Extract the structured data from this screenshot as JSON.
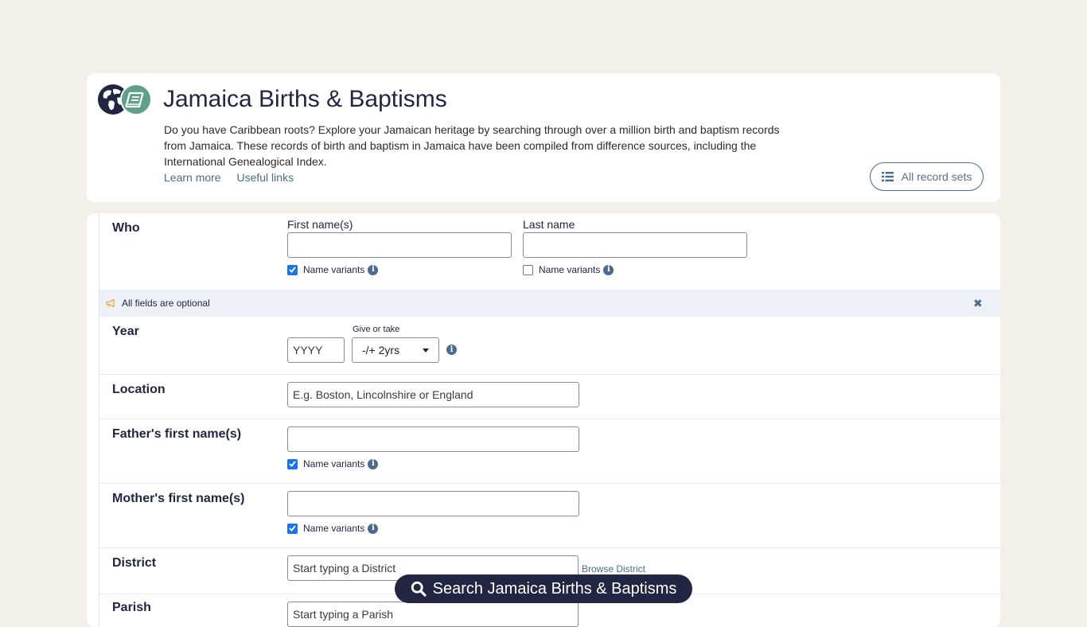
{
  "header": {
    "title": "Jamaica Births & Baptisms",
    "description": "Do you have Caribbean roots? Explore your Jamaican heritage by searching through over a million birth and baptism records from Jamaica. These records of birth and baptism in Jamaica have been compiled from difference sources, including the International Genealogical Index.",
    "learn_more": "Learn more",
    "useful_links": "Useful links",
    "all_record_sets": "All record sets",
    "icons": [
      "globe-icon",
      "book-icon",
      "list-icon"
    ]
  },
  "form": {
    "who": {
      "label": "Who",
      "first_name_label": "First name(s)",
      "first_name_value": "",
      "first_name_variants": "Name variants",
      "first_name_variants_checked": true,
      "last_name_label": "Last name",
      "last_name_value": "",
      "last_name_variants": "Name variants",
      "last_name_variants_checked": false
    },
    "notice": {
      "text": "All fields are optional"
    },
    "year": {
      "label": "Year",
      "placeholder": "YYYY",
      "give_or_take_label": "Give or take",
      "give_or_take_value": "-/+ 2yrs"
    },
    "location": {
      "label": "Location",
      "placeholder": "E.g. Boston, Lincolnshire or England"
    },
    "father": {
      "label": "Father's first name(s)",
      "value": "",
      "variants": "Name variants",
      "variants_checked": true
    },
    "mother": {
      "label": "Mother's first name(s)",
      "value": "",
      "variants": "Name variants",
      "variants_checked": true
    },
    "district": {
      "label": "District",
      "placeholder": "Start typing a District",
      "browse": "Browse District"
    },
    "parish": {
      "label": "Parish",
      "placeholder": "Start typing a Parish"
    }
  },
  "search_button": "Search Jamaica Births & Baptisms",
  "colors": {
    "page_bg": "#f3f0eb",
    "navy": "#222643",
    "link": "#4a6b8e",
    "green": "#5ea08a",
    "checkbox": "#1a73e8",
    "notice_bg": "#eef0f7"
  }
}
